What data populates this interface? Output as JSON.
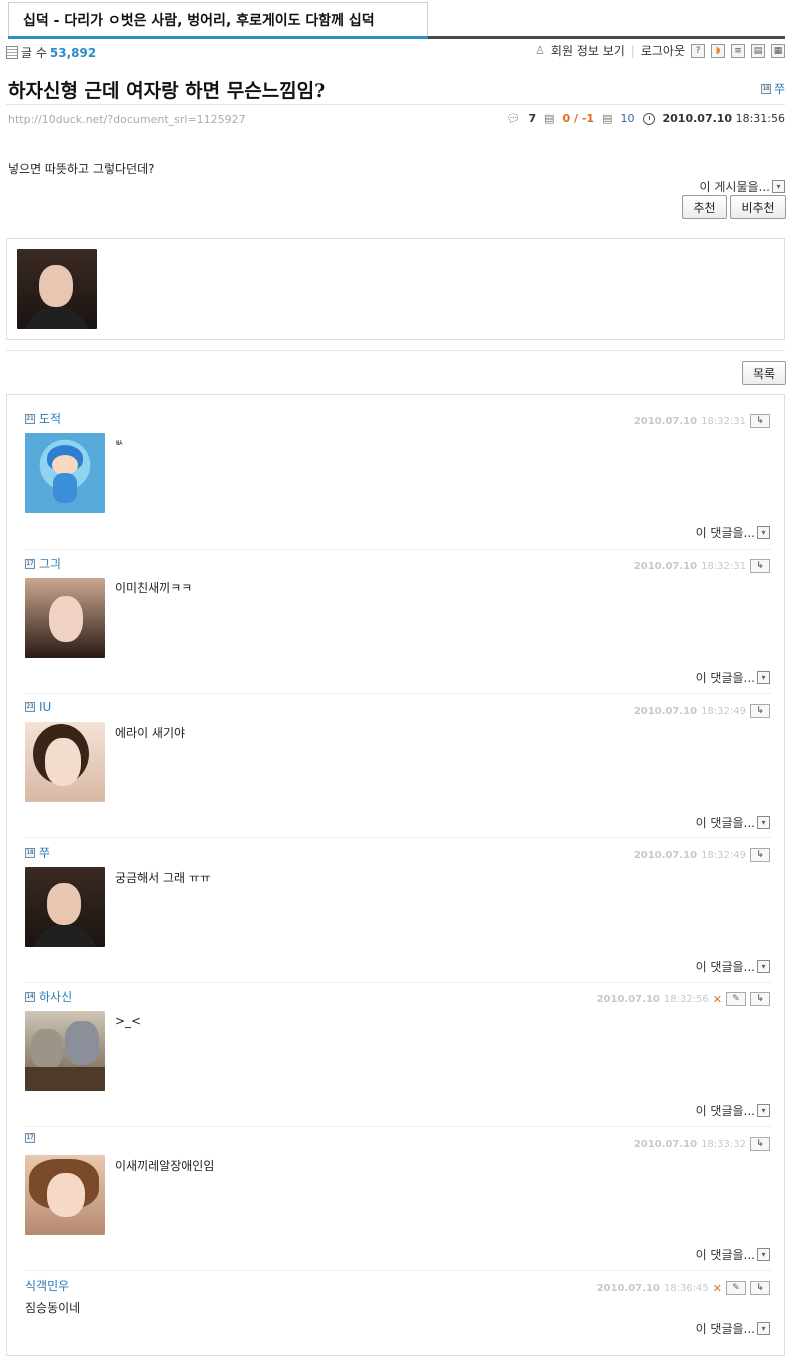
{
  "board": {
    "title": "십덕 - 다리가 ㅇ벗은 사람, 벙어리, 후로게이도 다함께 십덕"
  },
  "stats": {
    "count_label": "글 수",
    "count_value": "53,892"
  },
  "top_actions": {
    "member_info": "회원 정보 보기",
    "logout": "로그아웃"
  },
  "post": {
    "title": "하자신형 근데 여자랑 하면 무슨느낌임?",
    "author": "쭈",
    "author_level": "18",
    "url": "http://10duck.net/?document_srl=1125927",
    "comment_count": "7",
    "votes": "0 / -1",
    "views": "10",
    "date": "2010.07.10",
    "time": "18:31:56",
    "body": "넣으면 따뜻하고 그렇다던데?",
    "this_post": "이 게시물을...",
    "recommend": "추천",
    "not_recommend": "비추천"
  },
  "list_button": "목록",
  "comment_footer": "이 댓글을...",
  "comments": [
    {
      "level": "21",
      "name": "도적",
      "date": "2010.07.10",
      "time": "18:32:31",
      "text": "ㅄ",
      "avatar": "pocoyo"
    },
    {
      "level": "17",
      "name": "그긔",
      "date": "2010.07.10",
      "time": "18:32:31",
      "text": "이미친새끼ㅋㅋ",
      "avatar": "girl-b"
    },
    {
      "level": "23",
      "name": "IU",
      "date": "2010.07.10",
      "time": "18:32:49",
      "text": "에라이 새기야",
      "avatar": "iu"
    },
    {
      "level": "18",
      "name": "쭈",
      "date": "2010.07.10",
      "time": "18:32:49",
      "text": "궁금해서 그래 ㅠㅠ",
      "avatar": "girl-a"
    },
    {
      "level": "14",
      "name": "하사신",
      "date": "2010.07.10",
      "time": "18:32:56",
      "text": ">_<",
      "avatar": "cats"
    },
    {
      "level": "17",
      "name": "",
      "date": "2010.07.10",
      "time": "18:33:32",
      "text": "이새끼레알장애인임",
      "avatar": "girl-c"
    },
    {
      "level": "",
      "name": "식객민우",
      "date": "2010.07.10",
      "time": "18:36:45",
      "text": "짐승동이네",
      "avatar": ""
    }
  ]
}
